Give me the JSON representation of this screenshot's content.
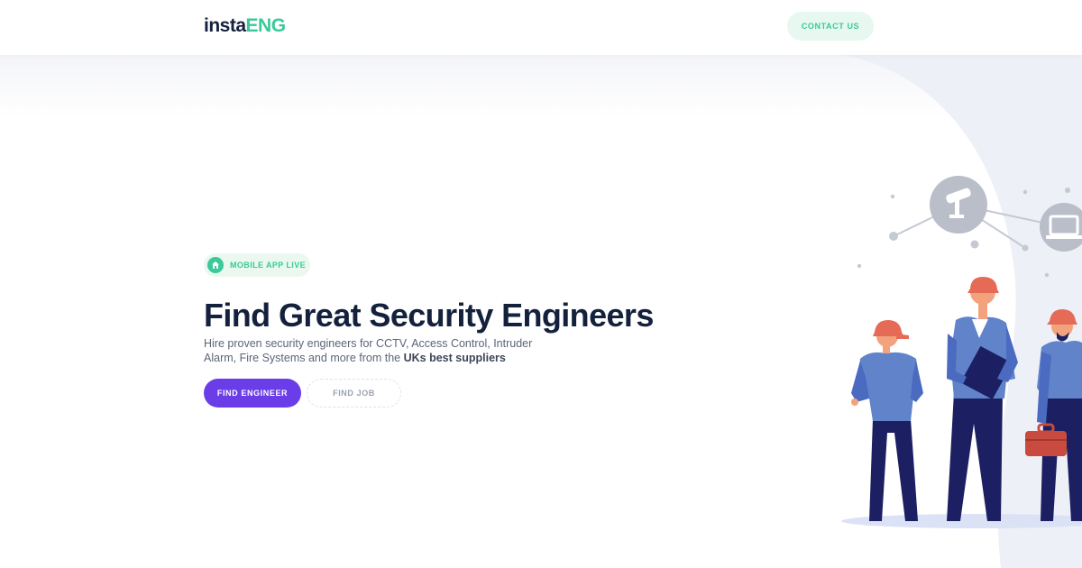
{
  "header": {
    "logo_part1": "insta",
    "logo_part2": "ENG",
    "contact_label": "CONTACT US"
  },
  "hero": {
    "badge_label": "MOBILE APP LIVE",
    "title": "Find Great Security Engineers",
    "subtitle_text": "Hire proven security engineers for CCTV, Access Control, Intruder Alarm, Fire Systems and more from the",
    "subtitle_bold": "UKs best suppliers",
    "primary_button": "FIND ENGINEER",
    "secondary_button": "FIND JOB"
  },
  "colors": {
    "brand_green": "#3ac99a",
    "brand_purple": "#6a3de8",
    "navy": "#14213d"
  },
  "icons": [
    "house-icon",
    "cctv-camera-icon",
    "laptop-icon"
  ]
}
